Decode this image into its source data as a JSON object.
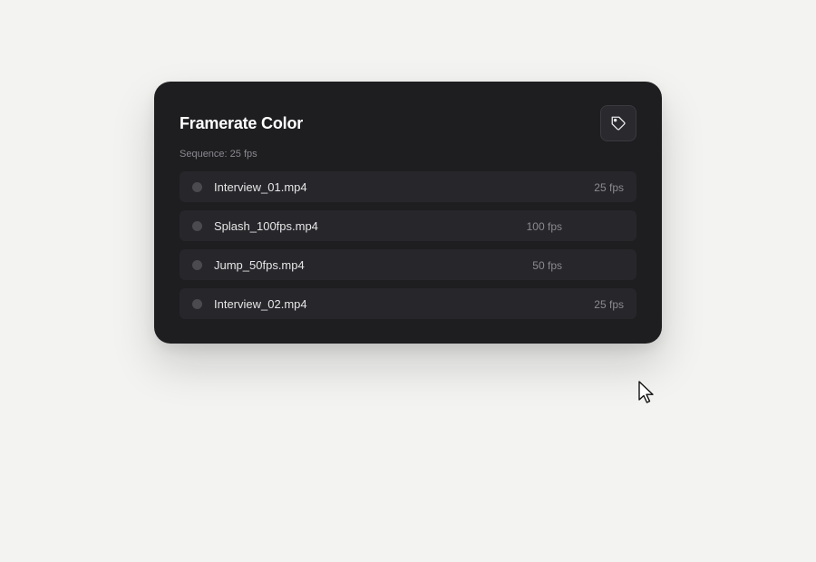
{
  "panel": {
    "title": "Framerate Color",
    "subtitle": "Sequence: 25 fps",
    "tag_icon": "tag-icon"
  },
  "clips": [
    {
      "name": "Interview_01.mp4",
      "fps": "25 fps"
    },
    {
      "name": "Splash_100fps.mp4",
      "fps": "100 fps"
    },
    {
      "name": "Jump_50fps.mp4",
      "fps": "50 fps"
    },
    {
      "name": "Interview_02.mp4",
      "fps": "25 fps"
    }
  ],
  "colors": {
    "card_bg": "#1e1e21",
    "row_bg": "#27272b",
    "dot": "#4a4a4f",
    "page_bg": "#f3f3f1"
  }
}
